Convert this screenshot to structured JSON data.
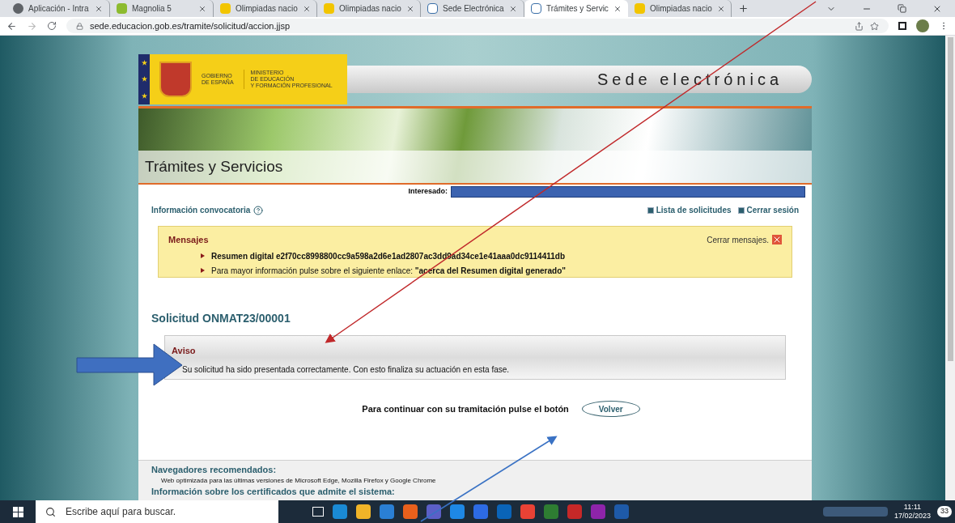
{
  "browser": {
    "tabs": [
      {
        "label": "Aplicación - Intra",
        "kind": "globe",
        "selected": false
      },
      {
        "label": "Magnolia 5",
        "kind": "magnolia",
        "selected": false
      },
      {
        "label": "Olimpiadas nacio",
        "kind": "crest",
        "selected": false
      },
      {
        "label": "Olimpiadas nacio",
        "kind": "crest",
        "selected": false
      },
      {
        "label": "Sede Electrónica",
        "kind": "sede",
        "selected": false
      },
      {
        "label": "Trámites y Servic",
        "kind": "sede",
        "selected": true
      },
      {
        "label": "Olimpiadas nacio",
        "kind": "crest",
        "selected": false
      }
    ],
    "url": "sede.educacion.gob.es/tramite/solicitud/accion.jjsp"
  },
  "header": {
    "government": [
      "GOBIERNO",
      "DE ESPAÑA"
    ],
    "ministry": [
      "MINISTERIO",
      "DE EDUCACIÓN",
      "Y FORMACIÓN PROFESIONAL"
    ],
    "site_title": "Sede electrónica"
  },
  "section_title": "Trámites y Servicios",
  "interesado_label": "Interesado:",
  "info_link": "Información convocatoria",
  "user_links": [
    "Lista de solicitudes",
    "Cerrar sesión"
  ],
  "messages": {
    "title": "Mensajes",
    "close": "Cerrar mensajes.",
    "items": [
      {
        "text": "**Resumen digital e2f70cc8998800cc9a598a2d6e1ad2807ac3dd9ad34ce1e41aaa0dc9114411db**"
      },
      {
        "text": "Para mayor información pulse sobre el siguiente enlace: **\"acerca del Resumen digital generado\"**"
      }
    ]
  },
  "request": {
    "title": "Solicitud ONMAT23/00001",
    "notice_title": "Aviso",
    "notice_items": [
      "Su solicitud ha sido presentada correctamente. Con esto finaliza su actuación en esta fase."
    ],
    "continue_text": "Para continuar con su tramitación pulse el botón",
    "button": "Volver"
  },
  "footer": {
    "browsers_title": "Navegadores recomendados:",
    "browsers_text": "Web optimizada para las últimas versiones de Microsoft Edge, Mozilla Firefox y Google Chrome",
    "certificates_title": "Información sobre los certificados que admite el sistema:"
  },
  "taskbar": {
    "search_placeholder": "Escribe aquí para buscar.",
    "time": "11:11",
    "date": "17/02/2023",
    "notifications": "33"
  }
}
